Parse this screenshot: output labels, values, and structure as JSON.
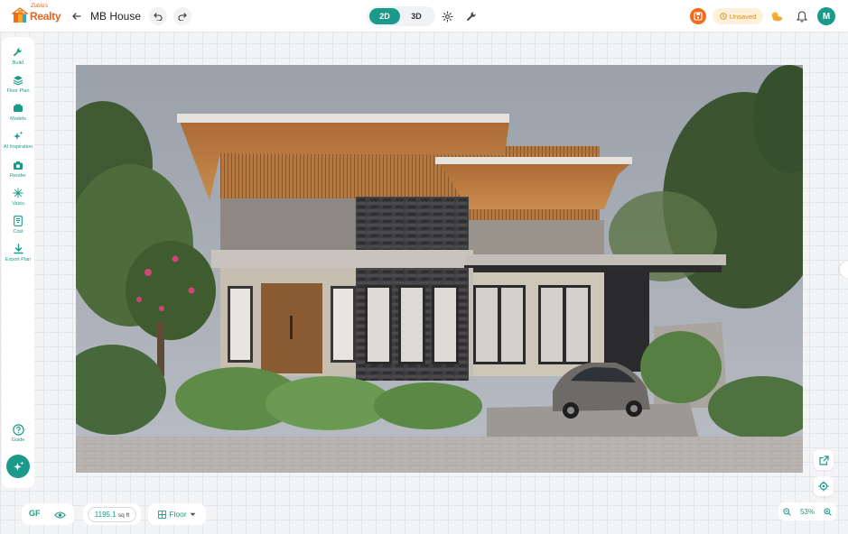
{
  "brand": {
    "logo_small": "Zubla's",
    "logo_text": "Realty",
    "accent_color": "#1a9a8a",
    "orange_color": "#f36b1c"
  },
  "header": {
    "project_name": "MB House",
    "view_modes": [
      "2D",
      "3D"
    ],
    "active_view": "2D",
    "status_text": "Unsaved",
    "avatar_initial": "M"
  },
  "sidebar": {
    "items": [
      {
        "label": "Build",
        "icon": "wrench-icon"
      },
      {
        "label": "Floor Plan",
        "icon": "layers-icon"
      },
      {
        "label": "Models",
        "icon": "models-icon"
      },
      {
        "label": "AI Inspiration",
        "icon": "sparkles-icon"
      },
      {
        "label": "Render",
        "icon": "camera-icon"
      },
      {
        "label": "Vastu",
        "icon": "compass-icon"
      },
      {
        "label": "Cost",
        "icon": "cost-icon"
      },
      {
        "label": "Export Plan",
        "icon": "download-icon"
      }
    ],
    "guide_label": "Guide"
  },
  "canvas": {
    "zoom": "53%"
  },
  "bottom": {
    "floor_code": "GF",
    "area_value": "1195.1",
    "area_unit": "sq ft",
    "floor_select": "Floor"
  }
}
